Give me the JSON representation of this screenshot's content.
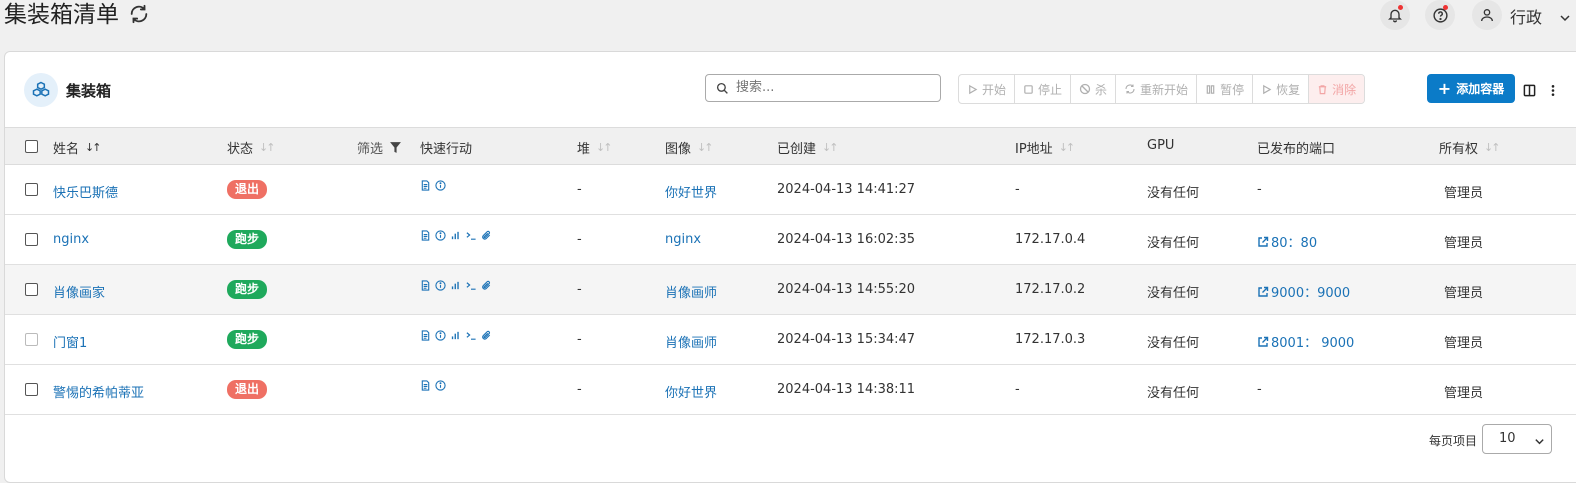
{
  "header": {
    "title": "集装箱清单",
    "user_name": "行政"
  },
  "panel": {
    "title": "集装箱",
    "search_placeholder": "搜索...",
    "actions": [
      {
        "name": "start",
        "label": "开始",
        "icon": "play-icon"
      },
      {
        "name": "stop",
        "label": "停止",
        "icon": "square-stop-icon"
      },
      {
        "name": "kill",
        "label": "杀",
        "icon": "ban-icon"
      },
      {
        "name": "restart",
        "label": "重新开始",
        "icon": "refresh-icon"
      },
      {
        "name": "pause",
        "label": "暂停",
        "icon": "pause-icon"
      },
      {
        "name": "resume",
        "label": "恢复",
        "icon": "play-icon"
      },
      {
        "name": "remove",
        "label": "消除",
        "icon": "trash-icon"
      }
    ],
    "add_button": "添加容器"
  },
  "table": {
    "columns": {
      "name": "姓名",
      "state": "状态",
      "filter": "筛选",
      "quick_actions": "快速行动",
      "stack": "堆",
      "image": "图像",
      "created": "已创建",
      "ip": "IP地址",
      "gpu": "GPU",
      "ports": "已发布的端口",
      "ownership": "所有权"
    },
    "rows": [
      {
        "name": "快乐巴斯德",
        "state": "退出",
        "state_kind": "exit",
        "quick": [
          "logs",
          "inspect"
        ],
        "stack": "-",
        "image": "你好世界",
        "created": "2024-04-13 14:41:27",
        "ip": "-",
        "gpu": "没有任何",
        "port": "-",
        "ownership": "管理员"
      },
      {
        "name": "nginx",
        "state": "跑步",
        "state_kind": "run",
        "quick": [
          "logs",
          "inspect",
          "stats",
          "console",
          "attach"
        ],
        "stack": "-",
        "image": "nginx",
        "created": "2024-04-13 16:02:35",
        "ip": "172.17.0.4",
        "gpu": "没有任何",
        "port": "80：80",
        "ownership": "管理员"
      },
      {
        "name": "肖像画家",
        "state": "跑步",
        "state_kind": "run",
        "quick": [
          "logs",
          "inspect",
          "stats",
          "console",
          "attach"
        ],
        "stack": "-",
        "image": "肖像画师",
        "created": "2024-04-13 14:55:20",
        "ip": "172.17.0.2",
        "gpu": "没有任何",
        "port": "9000：9000",
        "ownership": "管理员"
      },
      {
        "name": "门窗1",
        "state": "跑步",
        "state_kind": "run",
        "quick": [
          "logs",
          "inspect",
          "stats",
          "console",
          "attach"
        ],
        "stack": "-",
        "image": "肖像画师",
        "created": "2024-04-13 15:34:47",
        "ip": "172.17.0.3",
        "gpu": "没有任何",
        "port": "8001： 9000",
        "ownership": "管理员"
      },
      {
        "name": "警惕的希帕蒂亚",
        "state": "退出",
        "state_kind": "exit",
        "quick": [
          "logs",
          "inspect"
        ],
        "stack": "-",
        "image": "你好世界",
        "created": "2024-04-13 14:38:11",
        "ip": "-",
        "gpu": "没有任何",
        "port": "-",
        "ownership": "管理员"
      }
    ]
  },
  "footer": {
    "per_page_label": "每页项目",
    "per_page_value": "10"
  },
  "colors": {
    "accent": "#0b7bc8",
    "running": "#1fa95c",
    "exited": "#ef7064",
    "link": "#1b72b6"
  }
}
